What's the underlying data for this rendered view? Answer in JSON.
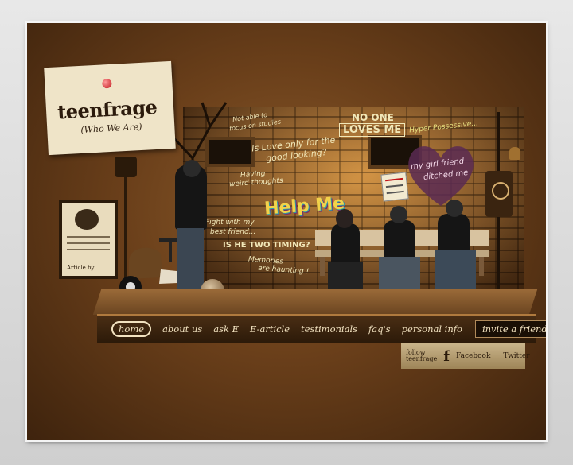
{
  "logo": {
    "title": "teenfrage",
    "subtitle": "(Who We Are)"
  },
  "wall_text": {
    "not_able": "Not able to",
    "focus": "focus on studies",
    "love_looks": "Is Love only for the",
    "love_looks2": "good looking?",
    "weird": "Having",
    "weird2": "weird thoughts",
    "no_one": "NO ONE",
    "loves_me": "LOVES ME",
    "hyper": "Hyper Possessive...",
    "girlfriend": "my girl friend",
    "girlfriend2": "ditched me",
    "help_me": "Help Me",
    "fight": "Fight with my",
    "fight2": "best friend...",
    "two_timing": "IS HE TWO TIMING?",
    "memories": "Memories",
    "memories2": "are haunting !"
  },
  "nav": {
    "home": "home",
    "about": "about us",
    "ask": "ask E",
    "article": "E-article",
    "testimonials": "testimonials",
    "faqs": "faq's",
    "personal": "personal info",
    "invite": "invite a friend"
  },
  "follow": {
    "label1": "follow",
    "label2": "teenfrage",
    "facebook_glyph": "f",
    "facebook": "Facebook",
    "twitter": "Twitter"
  },
  "poster": {
    "article_by": "Article by"
  },
  "colors": {
    "chalk": "#f1e7b8",
    "accent_red": "#c0141a",
    "brick": "#8b5a2b"
  }
}
